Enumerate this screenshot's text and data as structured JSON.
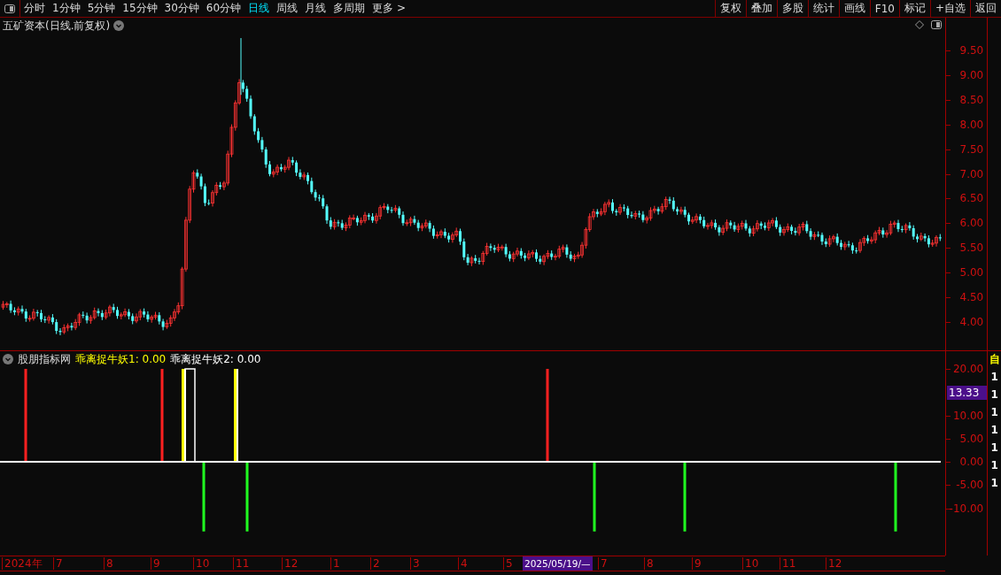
{
  "toolbar": {
    "periods": [
      {
        "label": "分时",
        "selected": false
      },
      {
        "label": "1分钟",
        "selected": false
      },
      {
        "label": "5分钟",
        "selected": false
      },
      {
        "label": "15分钟",
        "selected": false
      },
      {
        "label": "30分钟",
        "selected": false
      },
      {
        "label": "60分钟",
        "selected": false
      },
      {
        "label": "日线",
        "selected": true
      },
      {
        "label": "周线",
        "selected": false
      },
      {
        "label": "月线",
        "selected": false
      },
      {
        "label": "多周期",
        "selected": false
      }
    ],
    "more": "更多 >",
    "buttons": [
      "复权",
      "叠加",
      "多股",
      "统计",
      "画线",
      "F10",
      "标记",
      "+自选",
      "返回"
    ]
  },
  "price_pane": {
    "title": "五矿资本(日线.前复权)",
    "price_axis": [
      "9.50",
      "9.00",
      "8.50",
      "8.00",
      "7.50",
      "7.00",
      "6.50",
      "6.00",
      "5.50",
      "5.00",
      "4.50",
      "4.00"
    ]
  },
  "indicator_pane": {
    "name": "股朋指标网",
    "lines": [
      {
        "label": "乖离捉牛妖1: 0.00",
        "color": "#ffff00"
      },
      {
        "label": "乖离捉牛妖2: 0.00",
        "color": "#ffffff"
      }
    ],
    "axis": [
      "20.00",
      "10.00",
      "5.00",
      "0.00",
      "-5.00",
      "-10.00"
    ],
    "current_value": "13.33"
  },
  "right_strip": [
    {
      "text": "自",
      "color": "#ffff00"
    },
    {
      "text": "1",
      "color": "#ffffff"
    },
    {
      "text": "1",
      "color": "#ffffff"
    },
    {
      "text": "1",
      "color": "#ffffff"
    },
    {
      "text": "1",
      "color": "#ffffff"
    },
    {
      "text": "1",
      "color": "#ffffff"
    },
    {
      "text": "1",
      "color": "#ffffff"
    },
    {
      "text": "1",
      "color": "#ffffff"
    }
  ],
  "date_axis": [
    {
      "label": "2024年",
      "kind": "tick"
    },
    {
      "label": "7",
      "kind": "tick"
    },
    {
      "label": "8",
      "kind": "tick"
    },
    {
      "label": "9",
      "kind": "tick"
    },
    {
      "label": "10",
      "kind": "tick"
    },
    {
      "label": "11",
      "kind": "tick"
    },
    {
      "label": "12",
      "kind": "tick"
    },
    {
      "label": "1",
      "kind": "tick"
    },
    {
      "label": "2",
      "kind": "tick"
    },
    {
      "label": "3",
      "kind": "tick"
    },
    {
      "label": "4",
      "kind": "tick"
    },
    {
      "label": "5",
      "kind": "tick"
    },
    {
      "label": "2025/05/19/—",
      "kind": "cursor"
    },
    {
      "label": "7",
      "kind": "tick"
    },
    {
      "label": "8",
      "kind": "tick"
    },
    {
      "label": "9",
      "kind": "tick"
    },
    {
      "label": "10",
      "kind": "tick"
    },
    {
      "label": "11",
      "kind": "tick"
    },
    {
      "label": "12",
      "kind": "tick"
    }
  ]
}
